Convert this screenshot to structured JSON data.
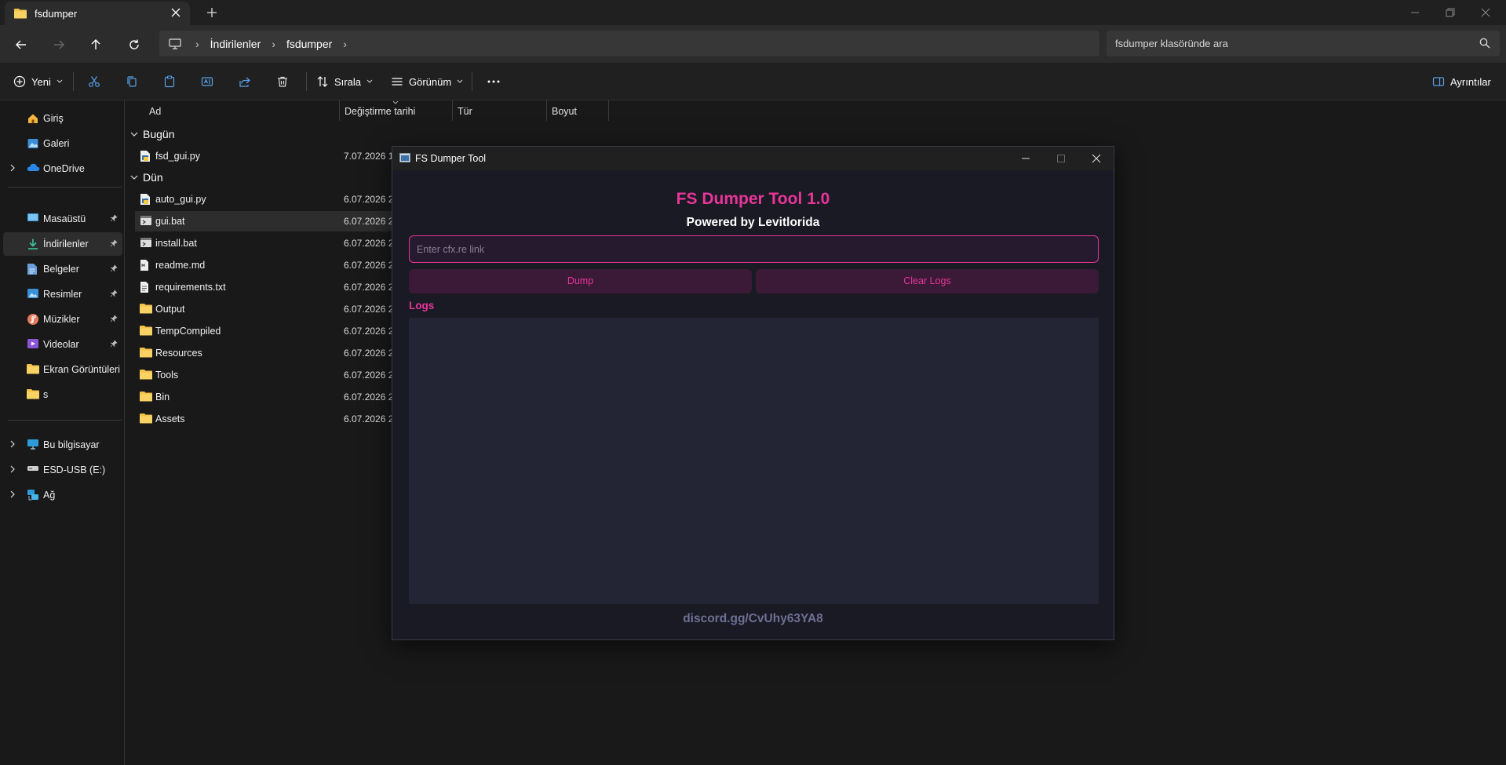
{
  "tab": {
    "title": "fsdumper"
  },
  "address": {
    "crumbs": [
      "İndirilenler",
      "fsdumper"
    ],
    "search_placeholder": "fsdumper klasöründe ara"
  },
  "commandbar": {
    "new_label": "Yeni",
    "sort_label": "Sırala",
    "view_label": "Görünüm",
    "details_label": "Ayrıntılar"
  },
  "sidebar": {
    "items": [
      {
        "label": "Giriş"
      },
      {
        "label": "Galeri"
      },
      {
        "label": "OneDrive"
      },
      {
        "label": "Masaüstü"
      },
      {
        "label": "İndirilenler"
      },
      {
        "label": "Belgeler"
      },
      {
        "label": "Resimler"
      },
      {
        "label": "Müzikler"
      },
      {
        "label": "Videolar"
      },
      {
        "label": "Ekran Görüntüleri"
      },
      {
        "label": "s"
      },
      {
        "label": "Bu bilgisayar"
      },
      {
        "label": "ESD-USB (E:)"
      },
      {
        "label": "Ağ"
      }
    ]
  },
  "filelist": {
    "columns": [
      "Ad",
      "Değiştirme tarihi",
      "Tür",
      "Boyut"
    ],
    "groups": [
      "Bugün",
      "Dün"
    ],
    "files": [
      {
        "name": "fsd_gui.py",
        "date": "7.07.2026 18"
      },
      {
        "name": "auto_gui.py",
        "date": "6.07.2026 20"
      },
      {
        "name": "gui.bat",
        "date": "6.07.2026 20"
      },
      {
        "name": "install.bat",
        "date": "6.07.2026 20"
      },
      {
        "name": "readme.md",
        "date": "6.07.2026 20"
      },
      {
        "name": "requirements.txt",
        "date": "6.07.2026 20"
      },
      {
        "name": "Output",
        "date": "6.07.2026 21"
      },
      {
        "name": "TempCompiled",
        "date": "6.07.2026 21"
      },
      {
        "name": "Resources",
        "date": "6.07.2026 20"
      },
      {
        "name": "Tools",
        "date": "6.07.2026 20"
      },
      {
        "name": "Bin",
        "date": "6.07.2026 20"
      },
      {
        "name": "Assets",
        "date": "6.07.2026 20"
      }
    ]
  },
  "app": {
    "window_title": "FS Dumper Tool",
    "heading": "FS Dumper Tool 1.0",
    "subheading": "Powered by Levitlorida",
    "input_placeholder": "Enter cfx.re link",
    "dump_label": "Dump",
    "clear_label": "Clear Logs",
    "logs_label": "Logs",
    "discord": "discord.gg/CvUhy63YA8",
    "accent_color": "#e8359a"
  }
}
